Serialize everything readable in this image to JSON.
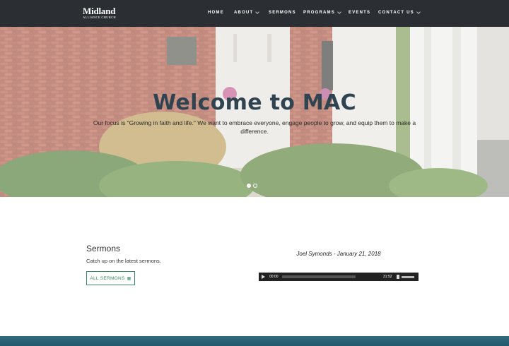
{
  "header": {
    "logo_main": "Midland",
    "logo_sub": "ALLIANCE CHURCH",
    "nav": [
      {
        "label": "HOME",
        "has_dropdown": false
      },
      {
        "label": "ABOUT",
        "has_dropdown": true
      },
      {
        "label": "SERMONS",
        "has_dropdown": false
      },
      {
        "label": "PROGRAMS",
        "has_dropdown": true
      },
      {
        "label": "EVENTS",
        "has_dropdown": false
      },
      {
        "label": "CONTACT US",
        "has_dropdown": true
      }
    ]
  },
  "hero": {
    "title": "Welcome to MAC",
    "text": "Our focus is \"Growing in faith and life.\" We want to embrace everyone, engage people to grow, and equip them to make a difference.",
    "slides": 2,
    "active_slide": 1
  },
  "sermons": {
    "title": "Sermons",
    "subtitle": "Catch up on the latest sermons.",
    "button_label": "ALL SERMONS",
    "audio_title": "Joel Symonds - January 21, 2018",
    "current_time": "00:00",
    "duration": "31:52",
    "progress": 0
  },
  "colors": {
    "nav_bg": "#2b2e33",
    "accent": "#3a8a66",
    "hero_title": "#2f4350"
  }
}
